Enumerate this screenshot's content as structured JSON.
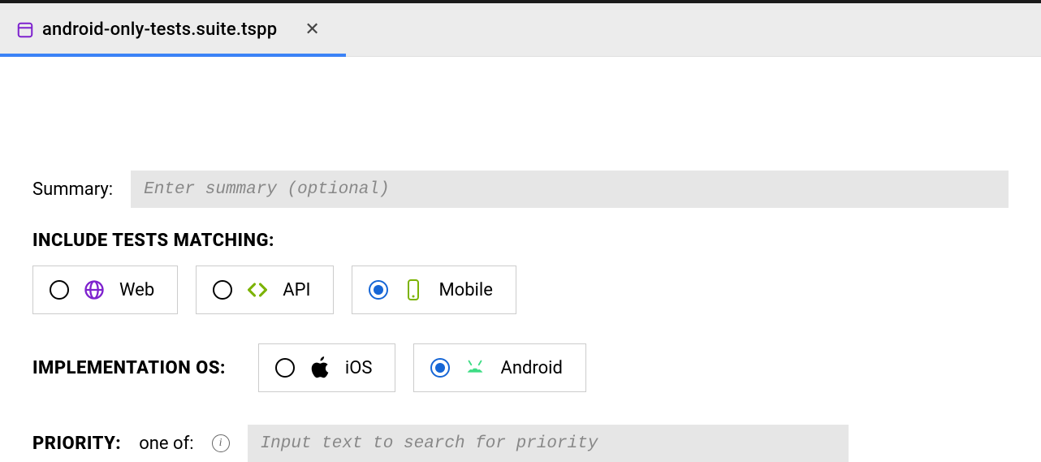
{
  "tab": {
    "filename": "android-only-tests.suite.tspp"
  },
  "summary": {
    "label": "Summary:",
    "placeholder": "Enter summary (optional)",
    "value": ""
  },
  "include_section": {
    "heading": "INCLUDE TESTS MATCHING:",
    "options": [
      {
        "label": "Web",
        "selected": false
      },
      {
        "label": "API",
        "selected": false
      },
      {
        "label": "Mobile",
        "selected": true
      }
    ]
  },
  "impl_os": {
    "heading": "IMPLEMENTATION OS:",
    "options": [
      {
        "label": "iOS",
        "selected": false
      },
      {
        "label": "Android",
        "selected": true
      }
    ]
  },
  "priority": {
    "heading": "PRIORITY:",
    "subtext": "one of:",
    "placeholder": "Input text to search for priority",
    "value": ""
  }
}
